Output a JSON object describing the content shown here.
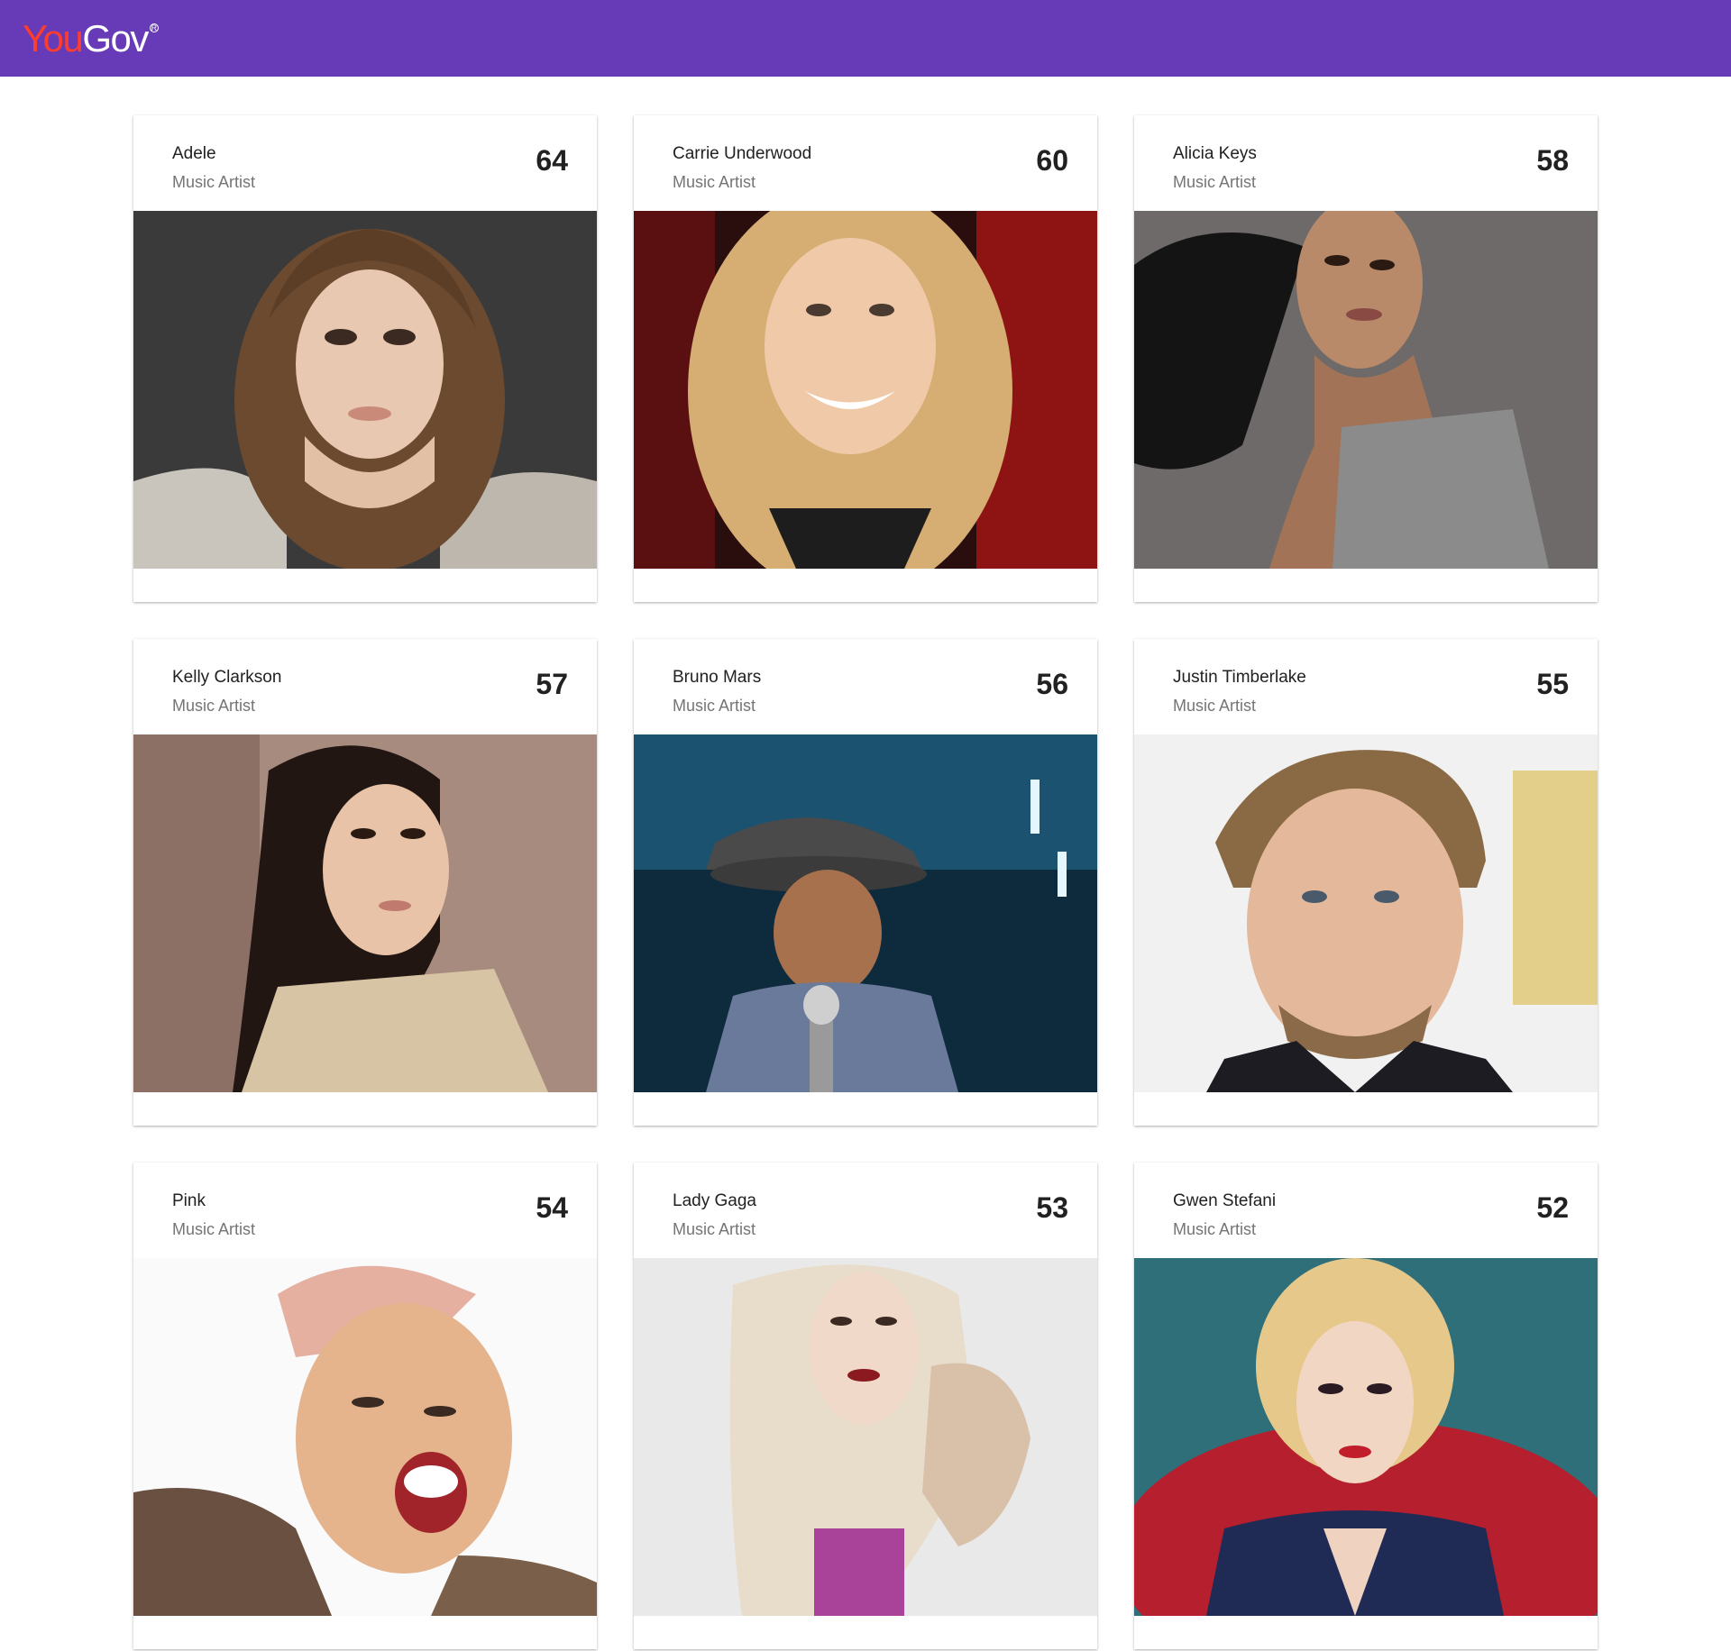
{
  "brand": {
    "logo_part1": "You",
    "logo_part2": "Gov",
    "logo_mark": "R"
  },
  "colors": {
    "header": "#673ab7",
    "logo_accent": "#ff3d2e"
  },
  "cards": [
    {
      "name": "Adele",
      "category": "Music Artist",
      "score": "64"
    },
    {
      "name": "Carrie Underwood",
      "category": "Music Artist",
      "score": "60"
    },
    {
      "name": "Alicia Keys",
      "category": "Music Artist",
      "score": "58"
    },
    {
      "name": "Kelly Clarkson",
      "category": "Music Artist",
      "score": "57"
    },
    {
      "name": "Bruno Mars",
      "category": "Music Artist",
      "score": "56"
    },
    {
      "name": "Justin Timberlake",
      "category": "Music Artist",
      "score": "55"
    },
    {
      "name": "Pink",
      "category": "Music Artist",
      "score": "54"
    },
    {
      "name": "Lady Gaga",
      "category": "Music Artist",
      "score": "53"
    },
    {
      "name": "Gwen Stefani",
      "category": "Music Artist",
      "score": "52"
    }
  ]
}
